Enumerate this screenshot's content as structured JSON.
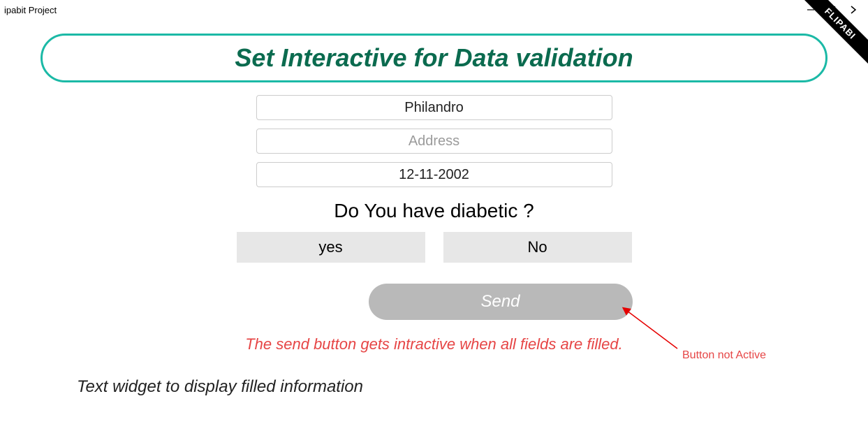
{
  "titlebar": {
    "title": "ipabit Project"
  },
  "ribbon": {
    "text": "FLIPABI"
  },
  "banner": {
    "title": "Set Interactive for Data validation"
  },
  "form": {
    "name_value": "Philandro",
    "address_placeholder": "Address",
    "address_value": "",
    "date_value": "12-11-2002",
    "question": "Do You have diabetic ?",
    "yes_label": "yes",
    "no_label": "No",
    "send_label": "Send",
    "hint": "The send button gets  intractive when all fields are filled."
  },
  "footer": {
    "text": "Text widget to display filled information"
  },
  "callout": {
    "label": "Button not Active"
  }
}
